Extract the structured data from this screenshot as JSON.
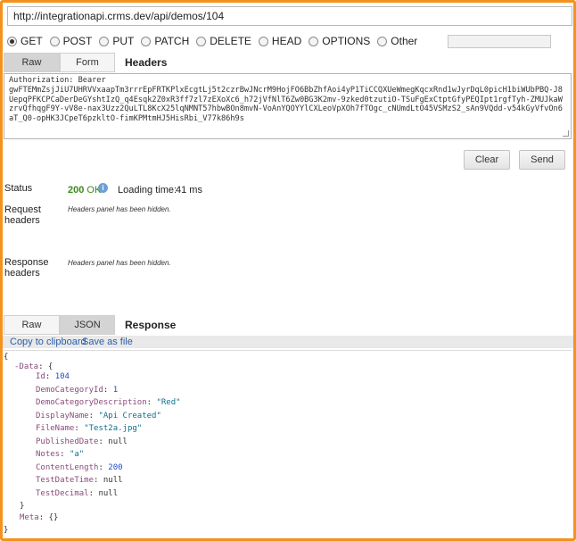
{
  "url": "http://integrationapi.crms.dev/api/demos/104",
  "methods": [
    {
      "label": "GET",
      "checked": true
    },
    {
      "label": "POST",
      "checked": false
    },
    {
      "label": "PUT",
      "checked": false
    },
    {
      "label": "PATCH",
      "checked": false
    },
    {
      "label": "DELETE",
      "checked": false
    },
    {
      "label": "HEAD",
      "checked": false
    },
    {
      "label": "OPTIONS",
      "checked": false
    },
    {
      "label": "Other",
      "checked": false
    }
  ],
  "request_tabs": {
    "raw": "Raw",
    "form": "Form",
    "title": "Headers"
  },
  "headers_text": "Authorization: Bearer\ngwFTEMmZsjJiU7UHRVVxaapTm3rrrEpFRTKPlxEcgtLj5t2czrBwJNcrM9HojFO6BbZhfAoi4yP1TiCCQXUeWmegKqcxRnd1wJyrDqL0picH1biWUbPBQ-J8UepqPFKCPCaDerDeGYshtIzQ_q4Esqk2Z0xR3ff7zl7zEXoXc6_h72jVfNlT6Zw0BG3K2mv-9zked0tzutiO-TSuFgExCtptGfyPEQIpt1rgfTyh-ZMUJkaWzrvQfhqgF9Y-vV8e-nax3Uzz2QuLTL8KcX25lqNMNT57hbwBOn8mvN-VoAnYQOYYlCXLeoVpXOh7fTOgc_cNUmdLtO45VSMzS2_sAn9VQdd-v54kGyVfvOn6aT_Q0-opHK3JCpeT6pzkltO-fimKPMtmHJ5HisRbi_V77k86h9s",
  "buttons": {
    "clear": "Clear",
    "send": "Send"
  },
  "status": {
    "label": "Status",
    "code": "200",
    "text": "OK",
    "loading_label": "Loading time:",
    "loading_value": "41 ms",
    "request_headers_label": "Request headers",
    "response_headers_label": "Response headers",
    "hidden_note": "Headers panel has been hidden."
  },
  "response_tabs": {
    "raw": "Raw",
    "json": "JSON",
    "title": "Response"
  },
  "response_links": {
    "copy": "Copy to clipboard",
    "save": "Save as file"
  },
  "json_view": {
    "open_brace": "{",
    "data_key": "-Data",
    "fields": [
      {
        "key": "Id",
        "value": "104",
        "kind": "n"
      },
      {
        "key": "DemoCategoryId",
        "value": "1",
        "kind": "n"
      },
      {
        "key": "DemoCategoryDescription",
        "value": "\"Red\"",
        "kind": "s"
      },
      {
        "key": "DisplayName",
        "value": "\"Api Created\"",
        "kind": "s"
      },
      {
        "key": "FileName",
        "value": "\"Test2a.jpg\"",
        "kind": "s"
      },
      {
        "key": "PublishedDate",
        "value": "null",
        "kind": "p"
      },
      {
        "key": "Notes",
        "value": "\"a\"",
        "kind": "s"
      },
      {
        "key": "ContentLength",
        "value": "200",
        "kind": "n"
      },
      {
        "key": "TestDateTime",
        "value": "null",
        "kind": "p"
      },
      {
        "key": "TestDecimal",
        "value": "null",
        "kind": "p"
      }
    ],
    "data_close": "}",
    "meta_key": "Meta",
    "meta_value": "{}",
    "close_brace": "}"
  },
  "colors": {
    "frame": "#f5921e",
    "ok": "#3b8a1a",
    "link": "#2a5fa8"
  }
}
